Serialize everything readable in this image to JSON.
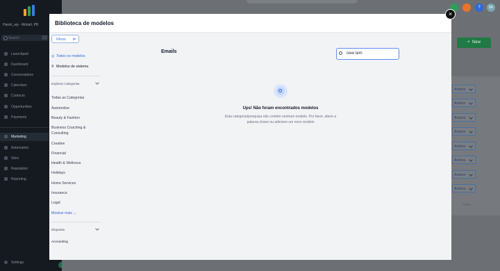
{
  "sidebar": {
    "location": "Harsh_wp - Mohali, PB",
    "search_placeholder": "Search",
    "items": [
      {
        "label": "Launchpad"
      },
      {
        "label": "Dashboard"
      },
      {
        "label": "Conversations"
      },
      {
        "label": "Calendars"
      },
      {
        "label": "Contacts"
      },
      {
        "label": "Opportunities"
      },
      {
        "label": "Payments"
      },
      {
        "label": "Marketing"
      },
      {
        "label": "Automation"
      },
      {
        "label": "Sites"
      },
      {
        "label": "Reputation"
      },
      {
        "label": "Reporting"
      }
    ],
    "settings_label": "Settings"
  },
  "topbar": {
    "help_label": "?",
    "avatar_label": "SK"
  },
  "background": {
    "new_button_label": "New",
    "actions_label": "Actions",
    "next_label": "Next"
  },
  "modal": {
    "title": "Biblioteca de modelos",
    "close_label": "×",
    "filter_label": "Filtros",
    "all_templates_label": "Todos os modelos",
    "system_templates_label": "Modelos de sistema",
    "explore_categories_label": "Explorar Categorias",
    "categories": [
      "Todas as Categorias",
      "Automotive",
      "Beauty & Fashion",
      "Business Coaching &",
      "Consulting",
      "Creative",
      "Financial",
      "Health & Wellness",
      "Holidays",
      "Home Services",
      "Insurance",
      "Legal"
    ],
    "show_more_label": "Mostrar mais",
    "tags_label": "Etiquetas",
    "tag_first": "Accounting",
    "section_title": "Emails",
    "search_value": "new tem",
    "empty_title": "Ups! Não foram encontrados modelos",
    "empty_description": "Esta categoria/pesquisa não contém nenhum modelo. Por favor, altere a palavra-chave ou adicione um novo modelo"
  },
  "colors": {
    "accent": "#2f68d9",
    "sidebar_bg": "#151a21",
    "new_button": "#1f7a45"
  }
}
